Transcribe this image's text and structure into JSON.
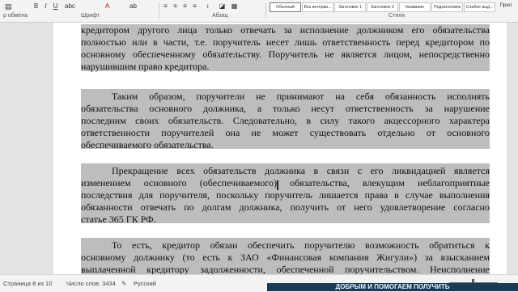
{
  "ribbon": {
    "clipboard_label": "Вставить",
    "clipboard_sub": "р обмена",
    "font_group_label": "Шрифт",
    "paragraph_group_label": "Абзац",
    "styles_group_label": "Стили",
    "styles": [
      "Обычный",
      "Без интерва...",
      "Заголовок 1",
      "Заголовок 2",
      "Название",
      "Подзаголовок",
      "Слабое выд..."
    ],
    "right_label": "Прил"
  },
  "document": {
    "lines": [
      "кредитором другого лица только отвечать за исполнение должником его обязательства",
      "полностью или в части, т.е. поручитель несет лишь ответственность перед кредитором по",
      "основному обеспеченному обязательству. Поручитель не является лицом, непосредственно",
      "нарушившим право кредитора.",
      "",
      "Таким образом, поручители не принимают на себя обязанность исполнять",
      "обязательства основного должника, а только несут ответственность за нарушение",
      "последним своих обязательств. Следовательно, в силу такого акцессорного характера",
      "ответственности поручителей она не может существовать отдельно от основного",
      "обеспечиваемого обязательства.",
      "",
      "Прекращение всех обязательств должника в связи с его ликвидацией является",
      "изменением основного (обеспечиваемого) обязательства, влекущим неблагоприятные",
      "последствия для поручителя, поскольку поручитель лишается права в случае выполнения",
      "обязанности отвечать по долгам должника, получить от него удовлетворение согласно",
      "статье 365 ГК РФ.",
      "",
      "То есть, кредитор обязан обеспечить поручителю возможность обратиться к",
      "основному должнику (то есть к ЗАО «Финансовая компания Жигули») за взысканием",
      "выплаченной кредитору задолженности, обеспеченной поручительством. Неисполнение"
    ]
  },
  "status": {
    "page": "Страница 8 из 10",
    "words": "Число слов: 3434",
    "language": "Русский",
    "banner": "ДОБРЫМ И ПОМОГАЕМ ПОЛУЧИТЬ"
  }
}
